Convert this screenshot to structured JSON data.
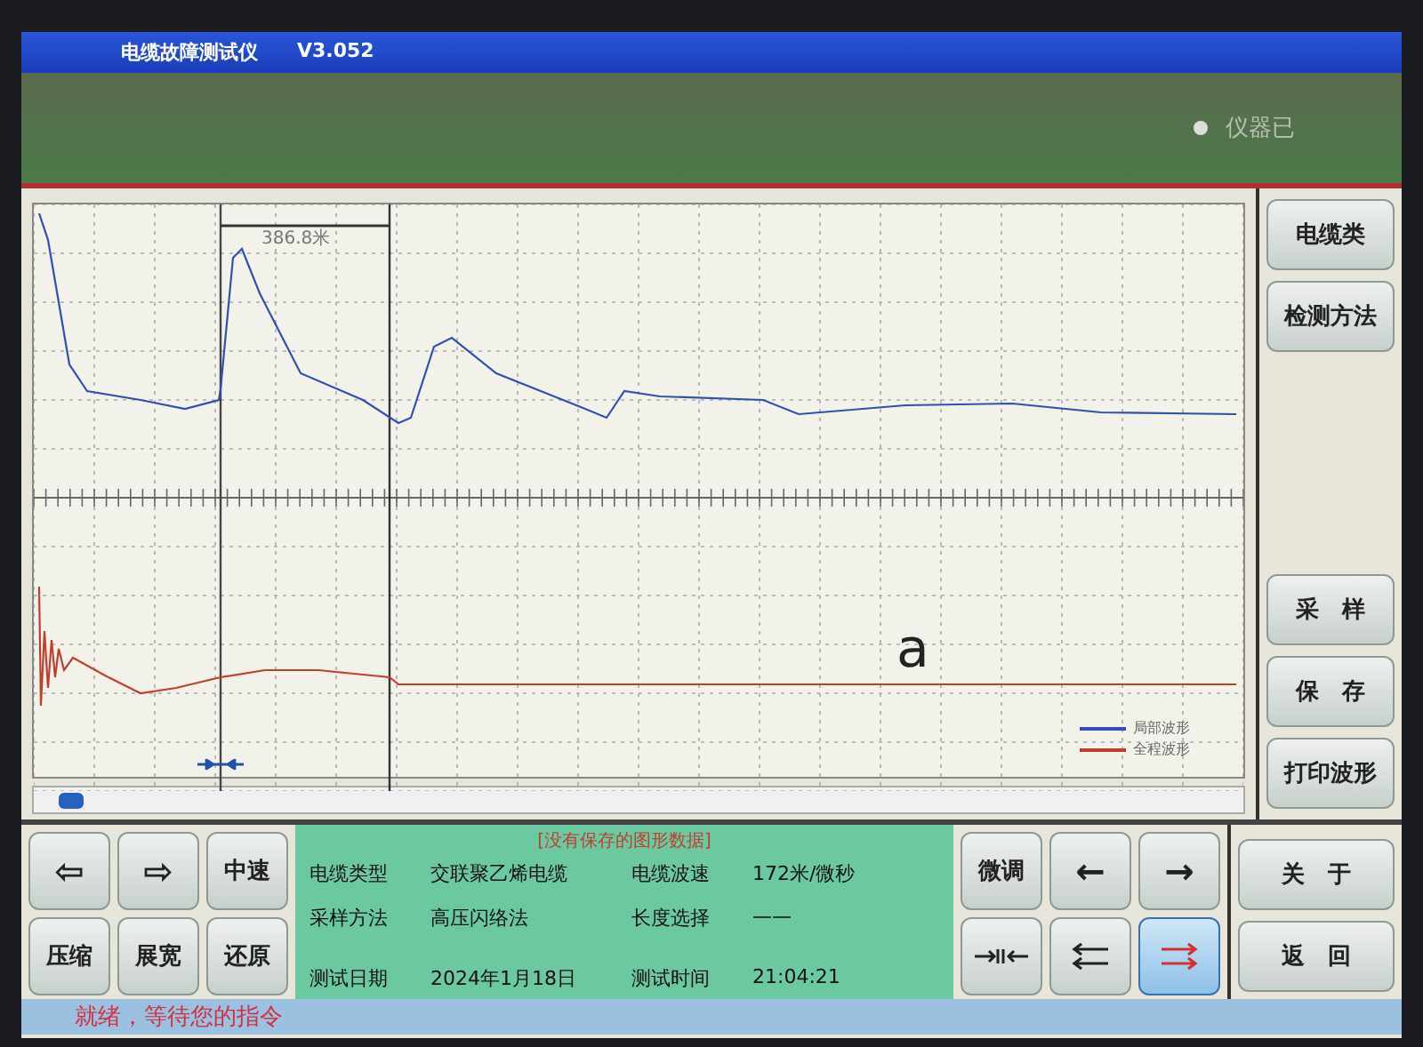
{
  "window": {
    "title": "电缆故障测试仪",
    "version": "V3.052"
  },
  "banner": {
    "status": "仪器已"
  },
  "chart": {
    "cursor_reading": "386.8米",
    "annotation": "a",
    "legend": [
      {
        "label": "局部波形",
        "color": "#3050b0"
      },
      {
        "label": "全程波形",
        "color": "#c04030"
      }
    ]
  },
  "side_buttons_top": [
    "电缆类",
    "检测方法"
  ],
  "side_buttons_mid": [
    "采　样",
    "保　存",
    "打印波形"
  ],
  "side_buttons_bottom": [
    "关　于",
    "返　回"
  ],
  "view_buttons": [
    {
      "kind": "text",
      "label": "⇦"
    },
    {
      "kind": "text",
      "label": "⇨"
    },
    {
      "kind": "text",
      "label": "中速"
    },
    {
      "kind": "text",
      "label": "压缩"
    },
    {
      "kind": "text",
      "label": "展宽"
    },
    {
      "kind": "text",
      "label": "还原"
    }
  ],
  "info": {
    "notice": "[没有保存的图形数据]",
    "fields": [
      {
        "label": "电缆类型",
        "value": "交联聚乙烯电缆"
      },
      {
        "label": "电缆波速",
        "value": "172米/微秒"
      },
      {
        "label": "采样方法",
        "value": "高压闪络法"
      },
      {
        "label": "长度选择",
        "value": "——"
      },
      {
        "label": "测试日期",
        "value": "2024年1月18日"
      },
      {
        "label": "测试时间",
        "value": "21:04:21"
      }
    ]
  },
  "cursor_buttons": [
    {
      "kind": "text",
      "label": "微调",
      "selected": false
    },
    {
      "kind": "text",
      "label": "←",
      "selected": false
    },
    {
      "kind": "text",
      "label": "→",
      "selected": false
    },
    {
      "kind": "converge",
      "selected": false
    },
    {
      "kind": "double-left",
      "selected": false
    },
    {
      "kind": "double-right",
      "selected": true
    }
  ],
  "status_bar": {
    "message": "就绪，等待您的指令"
  }
}
